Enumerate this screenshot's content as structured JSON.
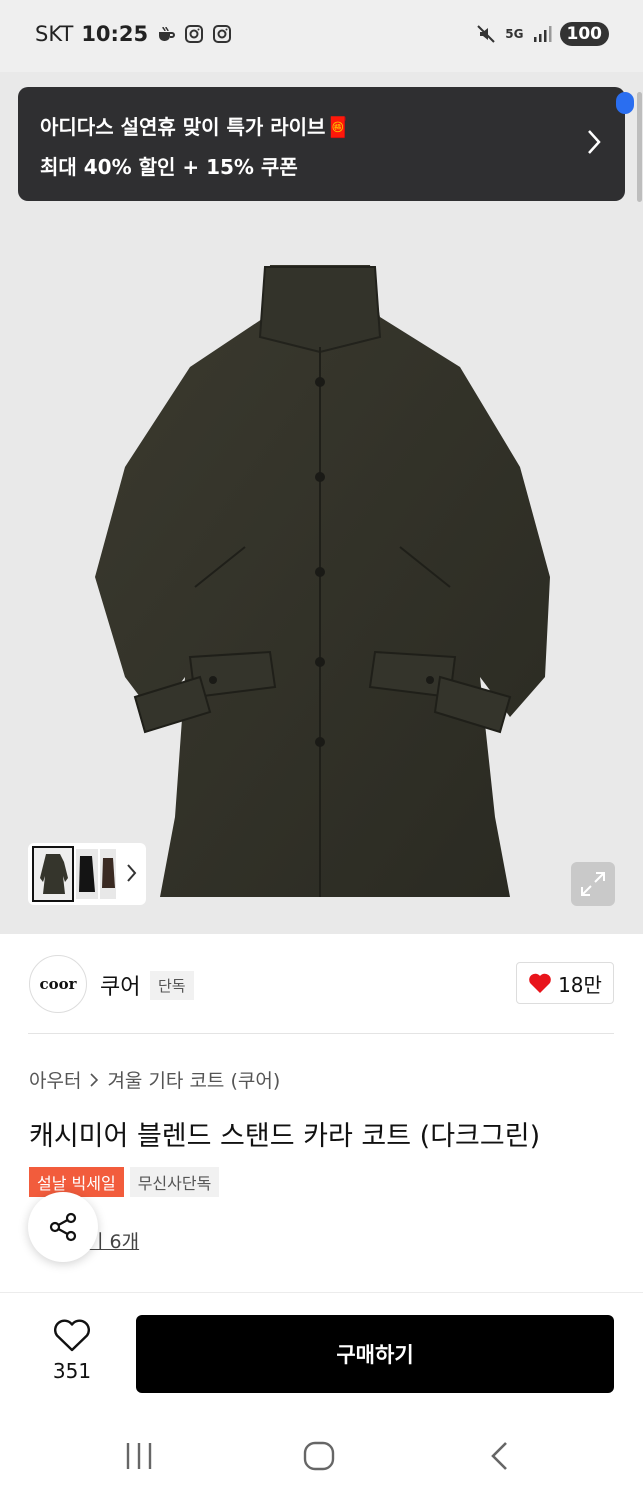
{
  "status_bar": {
    "carrier": "SKT",
    "time": "10:25",
    "network": "5G",
    "battery": "100",
    "icons": [
      "coffee-icon",
      "instagram-icon",
      "instagram-icon",
      "mute-icon",
      "signal-icon"
    ]
  },
  "toast": {
    "line1": "아디다스 설연휴 맞이 특가 라이브🧧",
    "line2": "최대 40% 할인 + 15% 쿠폰"
  },
  "brand": {
    "logo_text": "coor",
    "name": "쿠어",
    "tag": "단독",
    "likes": "18만"
  },
  "product": {
    "breadcrumb": [
      "아우터",
      "겨울 기타 코트 (쿠어)"
    ],
    "title": "캐시미어 블렌드 스탠드 카라 코트 (다크그린)",
    "badges": [
      "설날 빅세일",
      "무신사단독"
    ],
    "review": "기 6개"
  },
  "bottom_bar": {
    "wish_count": "351",
    "buy_label": "구매하기"
  },
  "colors": {
    "toast_bg": "#2f2f31",
    "badge_red": "#f25c3c",
    "buy_bg": "#000000",
    "heart": "#e8141b"
  }
}
